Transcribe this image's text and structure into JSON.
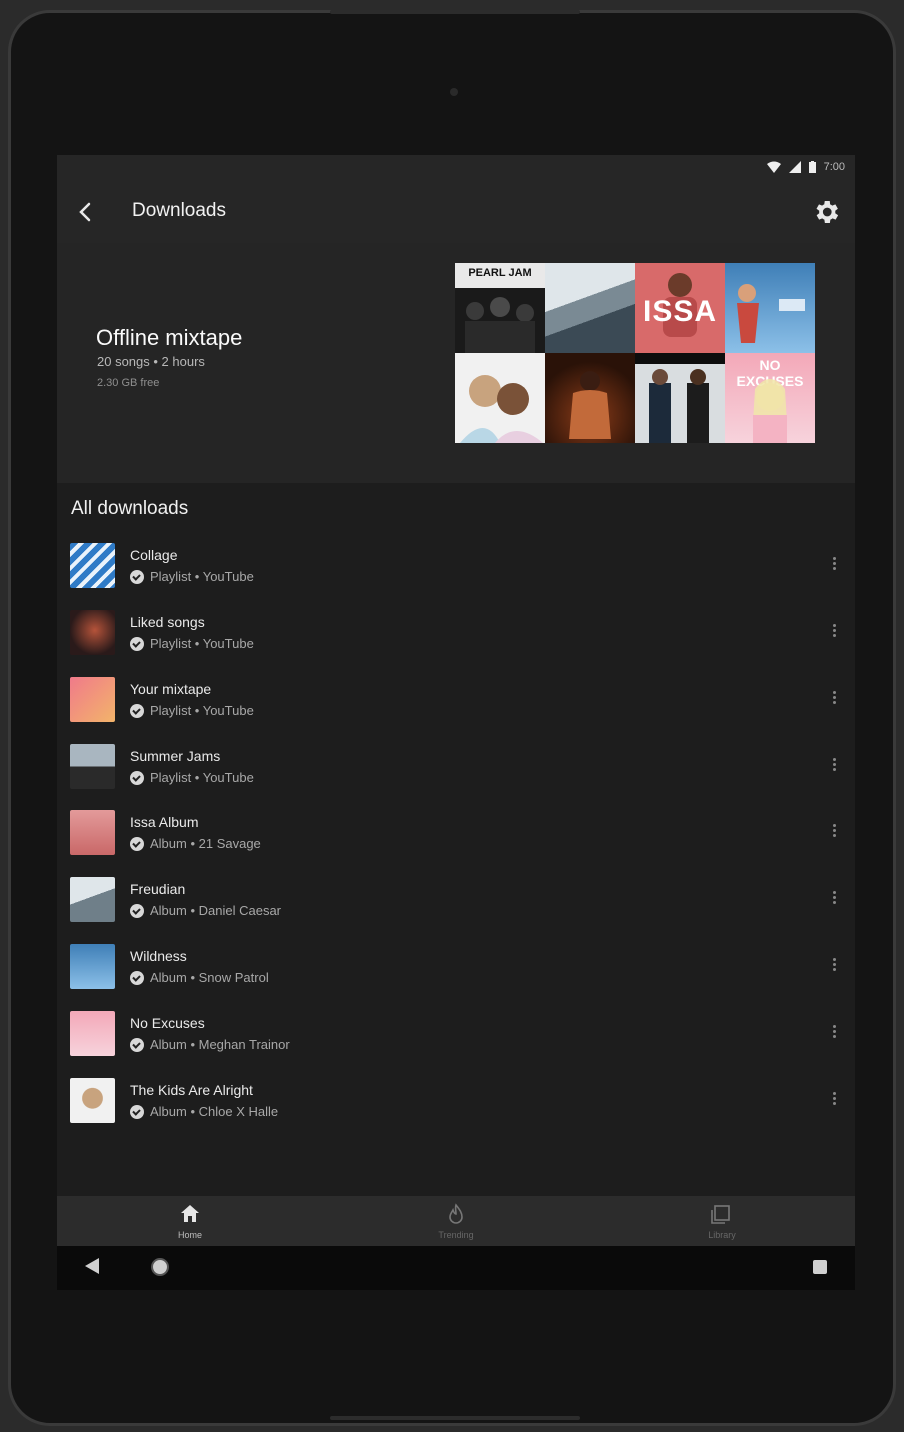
{
  "status_bar": {
    "time": "7:00"
  },
  "app_bar": {
    "title": "Downloads"
  },
  "header": {
    "title": "Offline mixtape",
    "subtitle": "20 songs • 2 hours",
    "storage": "2.30 GB free"
  },
  "album_grid": [
    {
      "name": "cover-1",
      "label": "PEARL JAM"
    },
    {
      "name": "cover-2",
      "label": ""
    },
    {
      "name": "cover-3",
      "label": "ISSA"
    },
    {
      "name": "cover-4",
      "label": ""
    },
    {
      "name": "cover-5",
      "label": ""
    },
    {
      "name": "cover-6",
      "label": ""
    },
    {
      "name": "cover-7",
      "label": ""
    },
    {
      "name": "cover-8",
      "label": "NO EXCUSES"
    }
  ],
  "section": {
    "title": "All downloads"
  },
  "downloads": [
    {
      "title": "Collage",
      "subtitle": "Playlist • YouTube"
    },
    {
      "title": "Liked songs",
      "subtitle": "Playlist • YouTube"
    },
    {
      "title": "Your mixtape",
      "subtitle": "Playlist • YouTube"
    },
    {
      "title": "Summer Jams",
      "subtitle": "Playlist • YouTube"
    },
    {
      "title": "Issa Album",
      "subtitle": "Album • 21 Savage"
    },
    {
      "title": "Freudian",
      "subtitle": "Album • Daniel Caesar"
    },
    {
      "title": "Wildness",
      "subtitle": "Album • Snow Patrol"
    },
    {
      "title": "No Excuses",
      "subtitle": "Album • Meghan Trainor"
    },
    {
      "title": "The Kids Are Alright",
      "subtitle": "Album • Chloe X Halle"
    }
  ],
  "bottom_nav": [
    {
      "label": "Home",
      "icon": "home-icon",
      "active": true
    },
    {
      "label": "Trending",
      "icon": "flame-icon",
      "active": false
    },
    {
      "label": "Library",
      "icon": "library-icon",
      "active": false
    }
  ],
  "colors": {
    "background": "#1d1d1d",
    "surface": "#262626",
    "text": "#f2f2f2",
    "secondary": "#a8a8a8"
  }
}
